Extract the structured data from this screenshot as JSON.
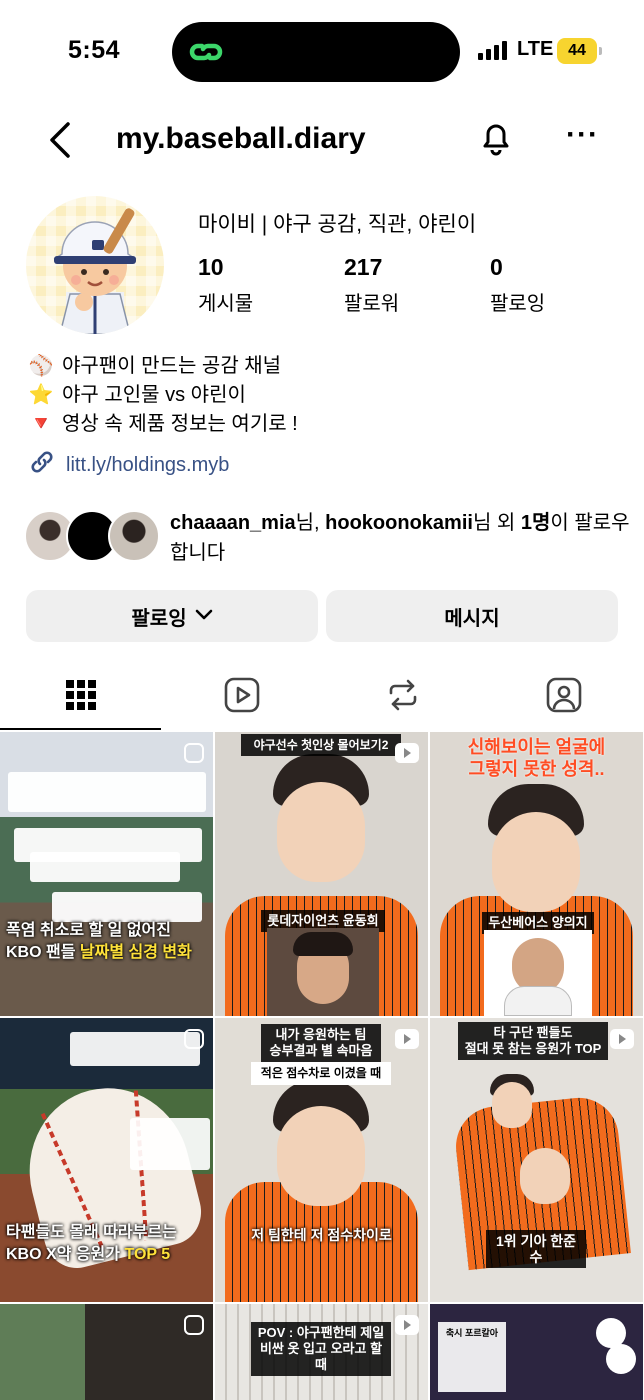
{
  "status_bar": {
    "time": "5:54",
    "network": "LTE",
    "battery": "44"
  },
  "header": {
    "username": "my.baseball.diary"
  },
  "profile": {
    "display_name": "마이비 | 야구 공감, 직관, 야린이",
    "stats": [
      {
        "value": "10",
        "label": "게시물"
      },
      {
        "value": "217",
        "label": "팔로워"
      },
      {
        "value": "0",
        "label": "팔로잉"
      }
    ],
    "bio": [
      {
        "emoji": "⚾",
        "text": "야구팬이 만드는 공감 채널"
      },
      {
        "emoji": "⭐",
        "text": "야구 고인물 vs 야린이"
      },
      {
        "emoji": "🔻",
        "text": "영상 속 제품 정보는 여기로 !"
      }
    ],
    "link": "litt.ly/holdings.myb",
    "mutual": {
      "user1": "chaaaan_mia",
      "sep1": "님, ",
      "user2": "hookoonokamii",
      "sep2": "님 외 ",
      "count": "1명",
      "tail": "이 팔로우합니다"
    }
  },
  "buttons": {
    "following": "팔로잉",
    "message": "메시지"
  },
  "tabs": [
    "grid-icon",
    "reels-icon",
    "repost-icon",
    "tagged-icon"
  ],
  "posts": [
    {
      "caption_line1": "폭염 취소로 할 일 없어진",
      "caption_line2a": "KBO 팬들 ",
      "caption_line2b": "날짜별 심경 변화"
    },
    {
      "top": "야구선수 첫인상 몰어보기2",
      "tag": "롯데자이언츠 윤동희"
    },
    {
      "top_line1": "신해보이는 얼굴에",
      "top_line2": "그렇지 못한 성격..",
      "tag": "두산베어스 양의지"
    },
    {
      "caption_line1": "타팬들도 몰래 따라부르는",
      "caption_line2a": "KBO X약 응원가 ",
      "caption_line2b": "TOP 5"
    },
    {
      "top_line1": "내가 응원하는 팀",
      "top_line2": "승부결과 별 속마음",
      "sub": "적은 점수차로 이겼을 때",
      "caption": "저 팀한테 저 점수차이로"
    },
    {
      "top_line1": "타 구단 팬들도",
      "top_line2": "절대 못 참는 응원가 TOP",
      "tag": "1위 기아 한준수"
    },
    {},
    {
      "top_line1": "POV : 야구팬한테 제일",
      "top_line2": "비싼 옷 입고 오라고 할 때"
    },
    {
      "note": "축시 포르칼아"
    }
  ],
  "colors": {
    "link": "#385185",
    "accent_orange": "#f26b1d",
    "button_bg": "#efefef",
    "battery": "#f7d42f"
  }
}
